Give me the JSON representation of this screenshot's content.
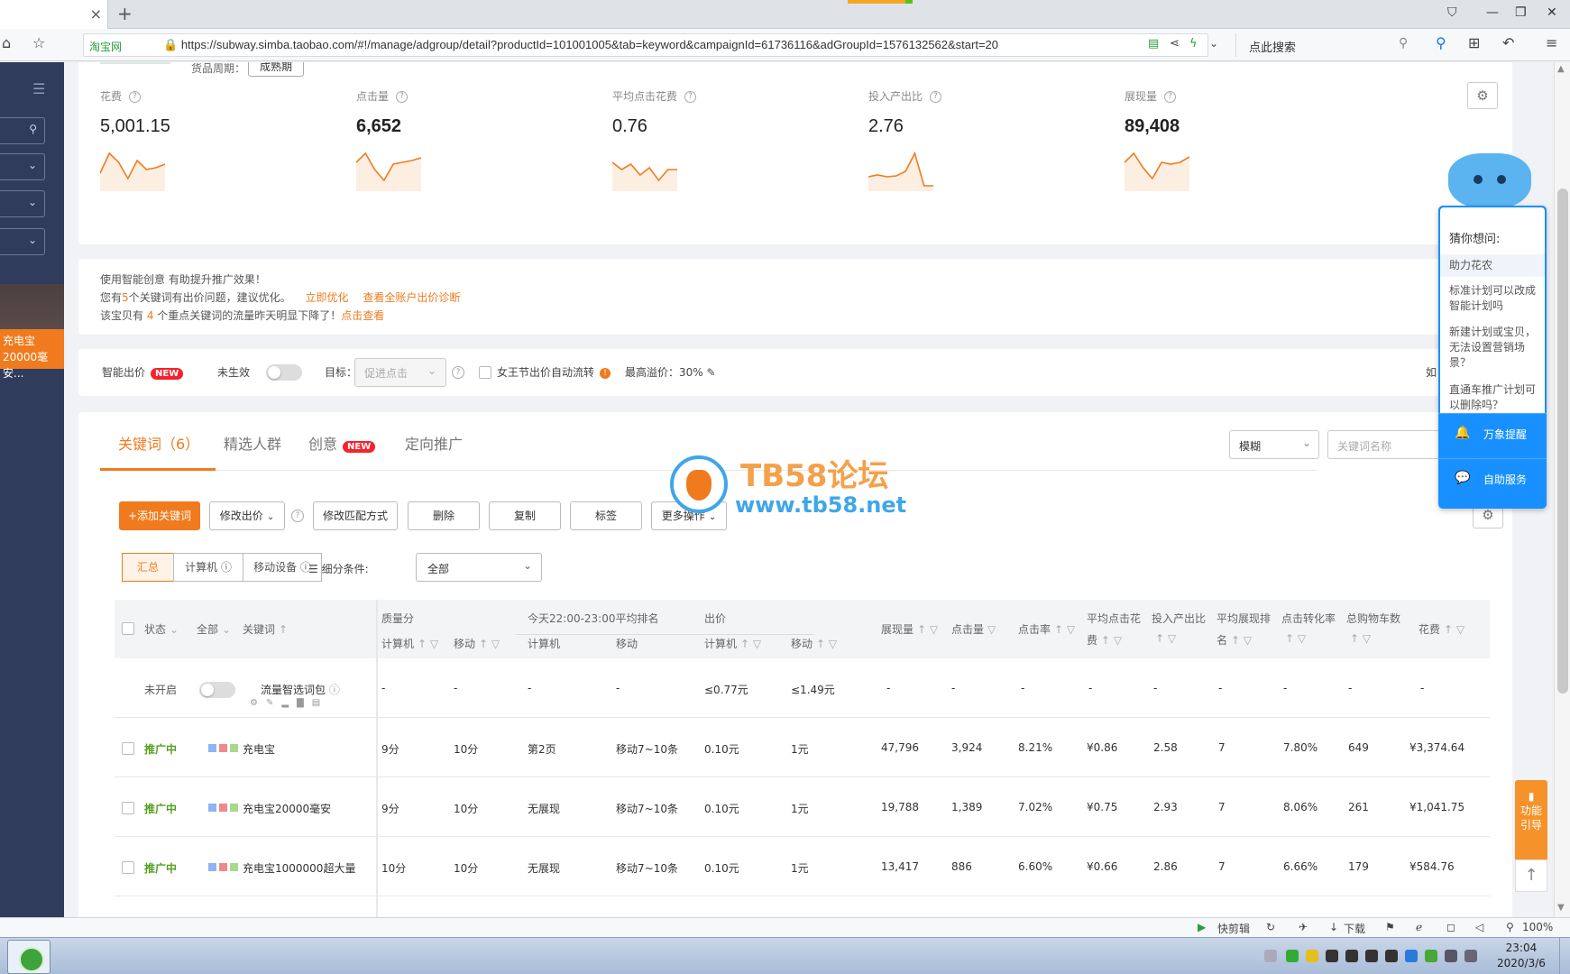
{
  "browser": {
    "tab_close": "×",
    "new_tab": "+",
    "site_label": "淘宝网",
    "url": "https://subway.simba.taobao.com/#!/manage/adgroup/detail?productId=101001005&tab=keyword&campaignId=61736116&adGroupId=1576132562&start=20",
    "search_placeholder": "点此搜索"
  },
  "sidebar": {
    "promo_text": "充电宝20000毫安..."
  },
  "product": {
    "cycle_label": "货品周期：",
    "cycle_value": "成熟期"
  },
  "metrics": [
    {
      "label": "花费",
      "value": "5,001.15",
      "bold": false,
      "trend": [
        18,
        40,
        30,
        12,
        32,
        22,
        24,
        28
      ]
    },
    {
      "label": "点击量",
      "value": "6,652",
      "bold": true,
      "trend": [
        30,
        40,
        22,
        10,
        28,
        30,
        32,
        35
      ]
    },
    {
      "label": "平均点击花费",
      "value": "0.76",
      "bold": false,
      "trend": [
        30,
        22,
        28,
        16,
        24,
        10,
        22,
        22
      ]
    },
    {
      "label": "投入产出比",
      "value": "2.76",
      "bold": false,
      "trend": [
        14,
        16,
        14,
        15,
        20,
        40,
        4,
        4
      ]
    },
    {
      "label": "展现量",
      "value": "89,408",
      "bold": true,
      "trend": [
        30,
        40,
        24,
        12,
        30,
        28,
        30,
        36
      ]
    }
  ],
  "tips": {
    "line1": "使用智能创意  有助提升推广效果！",
    "line2_pre": "您有",
    "line2_num": "5",
    "line2_post": "个关键词有出价问题，建议优化。",
    "line2_link1": "立即优化",
    "line2_link2": "查看全账户出价诊断",
    "line3_pre": "该宝贝有 ",
    "line3_num": "4",
    "line3_post": " 个重点关键词的流量昨天明显下降了！",
    "line3_link": "点击查看"
  },
  "smart_bid": {
    "label": "智能出价",
    "new_badge": "NEW",
    "status": "未生效",
    "goal_label": "目标：",
    "goal_value": "促进点击",
    "festival_label": "女王节出价自动流转",
    "premium": "最高溢价：30%",
    "right_cut": "如"
  },
  "tabs": [
    {
      "label": "关键词（6）",
      "active": true
    },
    {
      "label": "精选人群",
      "active": false
    },
    {
      "label": "创意",
      "active": false,
      "badge": "NEW"
    },
    {
      "label": "定向推广",
      "active": false
    }
  ],
  "search": {
    "mode": "模糊",
    "placeholder": "关键词名称"
  },
  "toolbar": {
    "add": "+添加关键词",
    "modify_bid": "修改出价",
    "match": "修改匹配方式",
    "delete": "删除",
    "copy": "复制",
    "tag": "标签",
    "more": "更多操作"
  },
  "segments": [
    "汇总",
    "计算机",
    "移动设备"
  ],
  "filter": {
    "label": "细分条件:",
    "value": "全部"
  },
  "table": {
    "headers": {
      "status": "状态",
      "all": "全部",
      "keyword": "关键词",
      "quality": "质量分",
      "q_pc": "计算机",
      "q_mobile": "移动",
      "rank": "今天22:00-23:00平均排名",
      "r_pc": "计算机",
      "r_mobile": "移动",
      "bid": "出价",
      "b_pc": "计算机",
      "b_mobile": "移动",
      "impressions": "展现量",
      "clicks": "点击量",
      "ctr": "点击率",
      "cpc1": "平均点击花",
      "cpc2": "费",
      "roi1": "投入产出比",
      "avgrank1": "平均展现排",
      "avgrank2": "名",
      "cvr": "点击转化率",
      "carts": "总购物车数",
      "cost": "花费"
    },
    "pack_row": {
      "status": "未开启",
      "name": "流量智选词包",
      "q_pc": "-",
      "q_mobile": "-",
      "r_pc": "-",
      "r_mobile": "-",
      "b_pc": "≤0.77元",
      "b_mobile": "≤1.49元",
      "impressions": "-",
      "clicks": "-",
      "ctr": "-",
      "cpc": "-",
      "roi": "-",
      "avgrank": "-",
      "cvr": "-",
      "carts": "-",
      "cost": "-"
    },
    "rows": [
      {
        "status": "推广中",
        "keyword": "充电宝",
        "q_pc": "9分",
        "q_mobile": "10分",
        "r_pc": "第2页",
        "r_mobile": "移动7~10条",
        "b_pc": "0.10元",
        "b_mobile": "1元",
        "impressions": "47,796",
        "clicks": "3,924",
        "ctr": "8.21%",
        "cpc": "¥0.86",
        "roi": "2.58",
        "avgrank": "7",
        "cvr": "7.80%",
        "carts": "649",
        "cost": "¥3,374.64"
      },
      {
        "status": "推广中",
        "keyword": "充电宝20000毫安",
        "q_pc": "9分",
        "q_mobile": "10分",
        "r_pc": "无展现",
        "r_mobile": "移动7~10条",
        "b_pc": "0.10元",
        "b_mobile": "1元",
        "impressions": "19,788",
        "clicks": "1,389",
        "ctr": "7.02%",
        "cpc": "¥0.75",
        "roi": "2.93",
        "avgrank": "7",
        "cvr": "8.06%",
        "carts": "261",
        "cost": "¥1,041.75"
      },
      {
        "status": "推广中",
        "keyword": "充电宝1000000超大量",
        "q_pc": "10分",
        "q_mobile": "10分",
        "r_pc": "无展现",
        "r_mobile": "移动7~10条",
        "b_pc": "0.10元",
        "b_mobile": "1元",
        "impressions": "13,417",
        "clicks": "886",
        "ctr": "6.60%",
        "cpc": "¥0.66",
        "roi": "2.86",
        "avgrank": "7",
        "cvr": "6.66%",
        "carts": "179",
        "cost": "¥584.76"
      }
    ]
  },
  "watermark": {
    "title": "TB58论坛",
    "url": "www.tb58.net"
  },
  "helper": {
    "title": "猜你想问:",
    "questions": [
      "助力花农",
      "标准计划可以改成智能计划吗",
      "新建计划或宝贝，无法设置营销场景？",
      "直通车推广计划可以删除吗？"
    ],
    "action1": "万象提醒",
    "action2": "自助服务"
  },
  "side_guide": "功能引导",
  "statusbar": {
    "clip": "快剪辑",
    "download": "下载",
    "zoom": "100%"
  },
  "taskbar": {
    "time": "23:04",
    "date": "2020/3/6"
  },
  "colors": {
    "accent": "#f07b1e",
    "sidebar": "#2f3c5c",
    "status_green": "#52a020",
    "helper_blue": "#1890ff",
    "trend_line": "#f07b1e"
  }
}
